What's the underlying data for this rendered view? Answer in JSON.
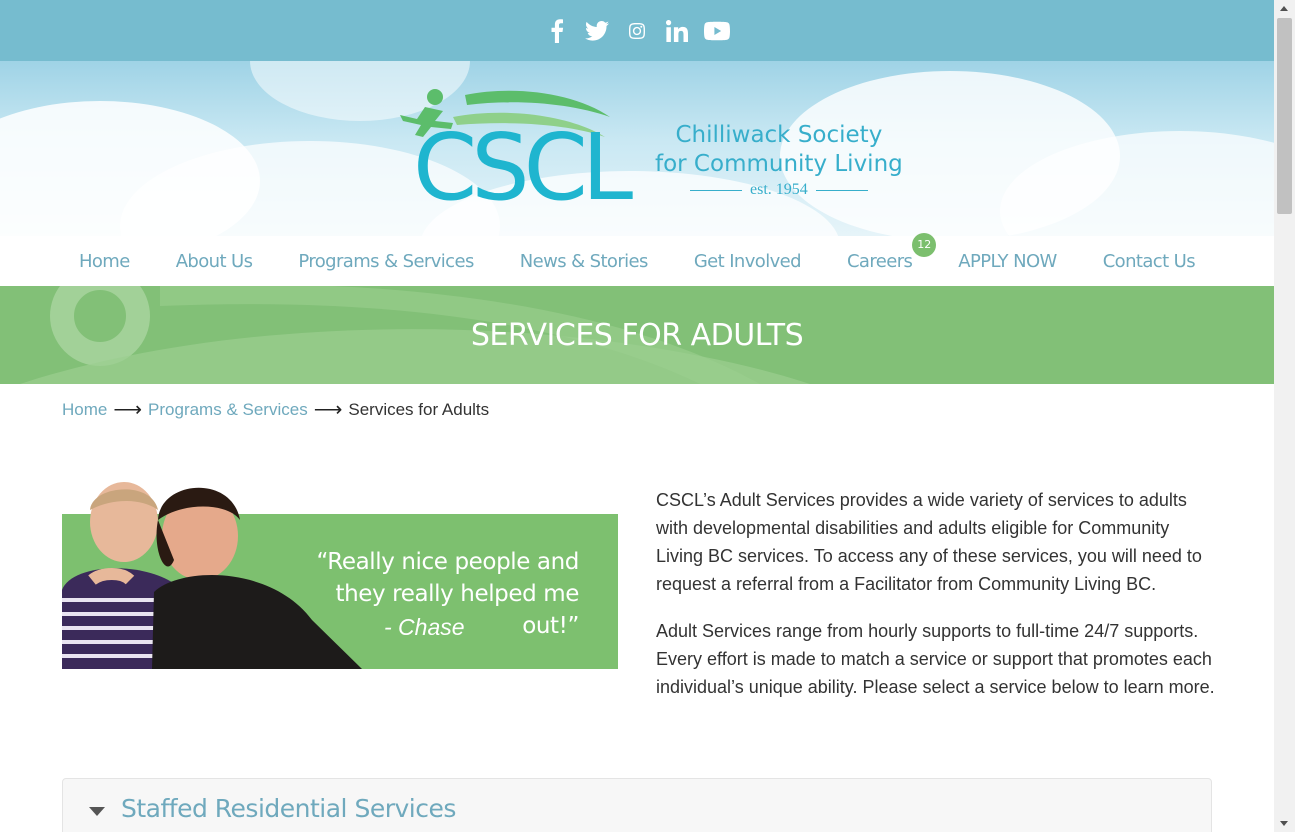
{
  "social": {
    "icons": [
      "facebook-icon",
      "twitter-icon",
      "instagram-icon",
      "linkedin-icon",
      "youtube-icon"
    ]
  },
  "logo": {
    "mark": "CSCL",
    "line1": "Chilliwack Society",
    "line2": "for Community Living",
    "est": "est. 1954"
  },
  "nav": {
    "items": [
      {
        "label": "Home"
      },
      {
        "label": "About Us"
      },
      {
        "label": "Programs & Services"
      },
      {
        "label": "News & Stories"
      },
      {
        "label": "Get Involved"
      },
      {
        "label": "Careers",
        "badge": "12"
      },
      {
        "label": "APPLY NOW"
      },
      {
        "label": "Contact Us"
      }
    ]
  },
  "banner": {
    "title": "SERVICES FOR ADULTS"
  },
  "breadcrumb": {
    "home": "Home",
    "arrow": "⟶",
    "programs": "Programs & Services",
    "current": "Services for Adults"
  },
  "promo": {
    "quote": "“Really nice people and they really helped me out!”",
    "author": "- Chase"
  },
  "content": {
    "p1": "CSCL’s Adult Services provides a wide variety of services to adults with developmental disabilities and adults eligible for Community Living BC services. To access any of these services, you will need to request a referral from a Facilitator from Community Living BC.",
    "p2": "Adult Services range from hourly supports to full-time 24/7 supports. Every effort is made to match a service or support that promotes each individual’s unique ability. Please select a service below to learn more."
  },
  "accordion": {
    "first_title": "Staffed Residential Services"
  },
  "colors": {
    "top_bar": "#76bccf",
    "nav_text": "#6fa9bd",
    "banner_green": "#82c077",
    "logo_teal": "#1fb5cf",
    "logo_green": "#5cbd6b"
  }
}
